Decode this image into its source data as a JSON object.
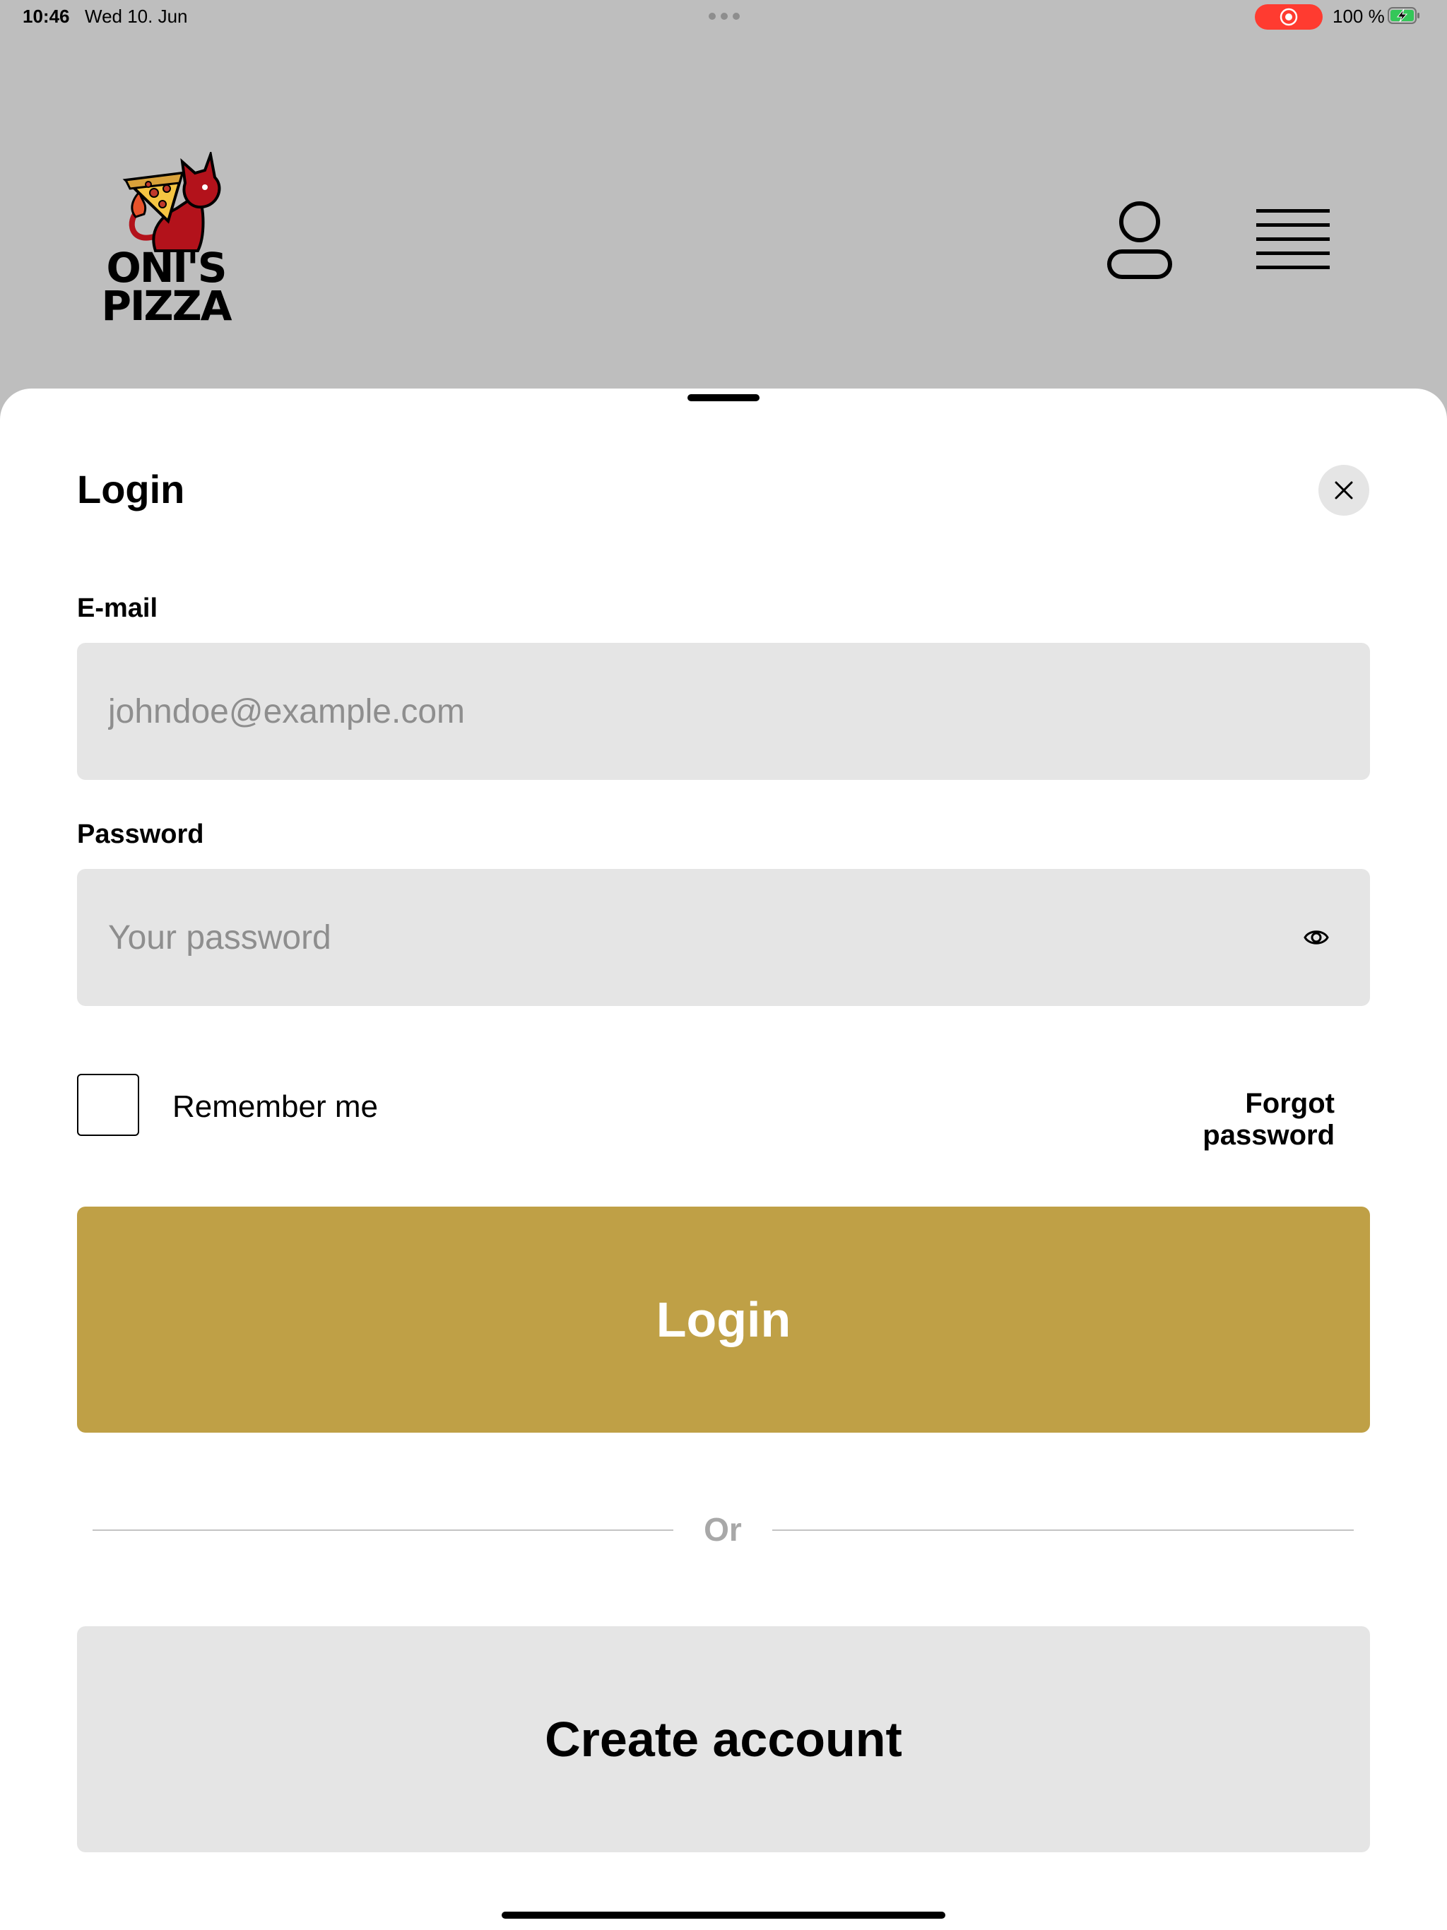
{
  "status_bar": {
    "time": "10:46",
    "date": "Wed 10. Jun",
    "battery_percent": "100 %",
    "battery_level": 1.0,
    "recording_active": true,
    "recording_color": "#ff3b30",
    "battery_color": "#34c759"
  },
  "header": {
    "logo": {
      "line1": "ONI'S",
      "line2": "PIZZA",
      "brand_color": "#b3121b"
    },
    "account_icon": "person-icon",
    "menu_icon": "hamburger-menu-icon"
  },
  "login_sheet": {
    "title": "Login",
    "close_icon": "close-icon",
    "email": {
      "label": "E-mail",
      "placeholder": "johndoe@example.com",
      "value": ""
    },
    "password": {
      "label": "Password",
      "placeholder": "Your password",
      "value": "",
      "toggle_icon": "eye-icon"
    },
    "remember_me": {
      "label": "Remember me",
      "checked": false
    },
    "forgot_password_label": "Forgot password",
    "login_button_label": "Login",
    "divider_text": "Or",
    "create_account_label": "Create account",
    "colors": {
      "accent": "#bfa046",
      "field_background": "#e5e5e5",
      "secondary_button": "#e5e5e5"
    }
  }
}
